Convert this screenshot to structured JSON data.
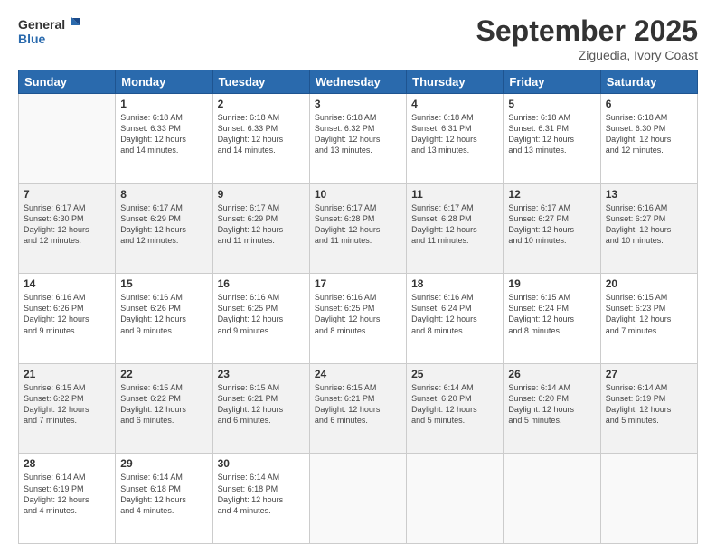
{
  "header": {
    "logo_line1": "General",
    "logo_line2": "Blue",
    "month": "September 2025",
    "location": "Ziguedia, Ivory Coast"
  },
  "weekdays": [
    "Sunday",
    "Monday",
    "Tuesday",
    "Wednesday",
    "Thursday",
    "Friday",
    "Saturday"
  ],
  "weeks": [
    [
      {
        "day": "",
        "content": ""
      },
      {
        "day": "1",
        "content": "Sunrise: 6:18 AM\nSunset: 6:33 PM\nDaylight: 12 hours\nand 14 minutes."
      },
      {
        "day": "2",
        "content": "Sunrise: 6:18 AM\nSunset: 6:33 PM\nDaylight: 12 hours\nand 14 minutes."
      },
      {
        "day": "3",
        "content": "Sunrise: 6:18 AM\nSunset: 6:32 PM\nDaylight: 12 hours\nand 13 minutes."
      },
      {
        "day": "4",
        "content": "Sunrise: 6:18 AM\nSunset: 6:31 PM\nDaylight: 12 hours\nand 13 minutes."
      },
      {
        "day": "5",
        "content": "Sunrise: 6:18 AM\nSunset: 6:31 PM\nDaylight: 12 hours\nand 13 minutes."
      },
      {
        "day": "6",
        "content": "Sunrise: 6:18 AM\nSunset: 6:30 PM\nDaylight: 12 hours\nand 12 minutes."
      }
    ],
    [
      {
        "day": "7",
        "content": "Sunrise: 6:17 AM\nSunset: 6:30 PM\nDaylight: 12 hours\nand 12 minutes."
      },
      {
        "day": "8",
        "content": "Sunrise: 6:17 AM\nSunset: 6:29 PM\nDaylight: 12 hours\nand 12 minutes."
      },
      {
        "day": "9",
        "content": "Sunrise: 6:17 AM\nSunset: 6:29 PM\nDaylight: 12 hours\nand 11 minutes."
      },
      {
        "day": "10",
        "content": "Sunrise: 6:17 AM\nSunset: 6:28 PM\nDaylight: 12 hours\nand 11 minutes."
      },
      {
        "day": "11",
        "content": "Sunrise: 6:17 AM\nSunset: 6:28 PM\nDaylight: 12 hours\nand 11 minutes."
      },
      {
        "day": "12",
        "content": "Sunrise: 6:17 AM\nSunset: 6:27 PM\nDaylight: 12 hours\nand 10 minutes."
      },
      {
        "day": "13",
        "content": "Sunrise: 6:16 AM\nSunset: 6:27 PM\nDaylight: 12 hours\nand 10 minutes."
      }
    ],
    [
      {
        "day": "14",
        "content": "Sunrise: 6:16 AM\nSunset: 6:26 PM\nDaylight: 12 hours\nand 9 minutes."
      },
      {
        "day": "15",
        "content": "Sunrise: 6:16 AM\nSunset: 6:26 PM\nDaylight: 12 hours\nand 9 minutes."
      },
      {
        "day": "16",
        "content": "Sunrise: 6:16 AM\nSunset: 6:25 PM\nDaylight: 12 hours\nand 9 minutes."
      },
      {
        "day": "17",
        "content": "Sunrise: 6:16 AM\nSunset: 6:25 PM\nDaylight: 12 hours\nand 8 minutes."
      },
      {
        "day": "18",
        "content": "Sunrise: 6:16 AM\nSunset: 6:24 PM\nDaylight: 12 hours\nand 8 minutes."
      },
      {
        "day": "19",
        "content": "Sunrise: 6:15 AM\nSunset: 6:24 PM\nDaylight: 12 hours\nand 8 minutes."
      },
      {
        "day": "20",
        "content": "Sunrise: 6:15 AM\nSunset: 6:23 PM\nDaylight: 12 hours\nand 7 minutes."
      }
    ],
    [
      {
        "day": "21",
        "content": "Sunrise: 6:15 AM\nSunset: 6:22 PM\nDaylight: 12 hours\nand 7 minutes."
      },
      {
        "day": "22",
        "content": "Sunrise: 6:15 AM\nSunset: 6:22 PM\nDaylight: 12 hours\nand 6 minutes."
      },
      {
        "day": "23",
        "content": "Sunrise: 6:15 AM\nSunset: 6:21 PM\nDaylight: 12 hours\nand 6 minutes."
      },
      {
        "day": "24",
        "content": "Sunrise: 6:15 AM\nSunset: 6:21 PM\nDaylight: 12 hours\nand 6 minutes."
      },
      {
        "day": "25",
        "content": "Sunrise: 6:14 AM\nSunset: 6:20 PM\nDaylight: 12 hours\nand 5 minutes."
      },
      {
        "day": "26",
        "content": "Sunrise: 6:14 AM\nSunset: 6:20 PM\nDaylight: 12 hours\nand 5 minutes."
      },
      {
        "day": "27",
        "content": "Sunrise: 6:14 AM\nSunset: 6:19 PM\nDaylight: 12 hours\nand 5 minutes."
      }
    ],
    [
      {
        "day": "28",
        "content": "Sunrise: 6:14 AM\nSunset: 6:19 PM\nDaylight: 12 hours\nand 4 minutes."
      },
      {
        "day": "29",
        "content": "Sunrise: 6:14 AM\nSunset: 6:18 PM\nDaylight: 12 hours\nand 4 minutes."
      },
      {
        "day": "30",
        "content": "Sunrise: 6:14 AM\nSunset: 6:18 PM\nDaylight: 12 hours\nand 4 minutes."
      },
      {
        "day": "",
        "content": ""
      },
      {
        "day": "",
        "content": ""
      },
      {
        "day": "",
        "content": ""
      },
      {
        "day": "",
        "content": ""
      }
    ]
  ]
}
